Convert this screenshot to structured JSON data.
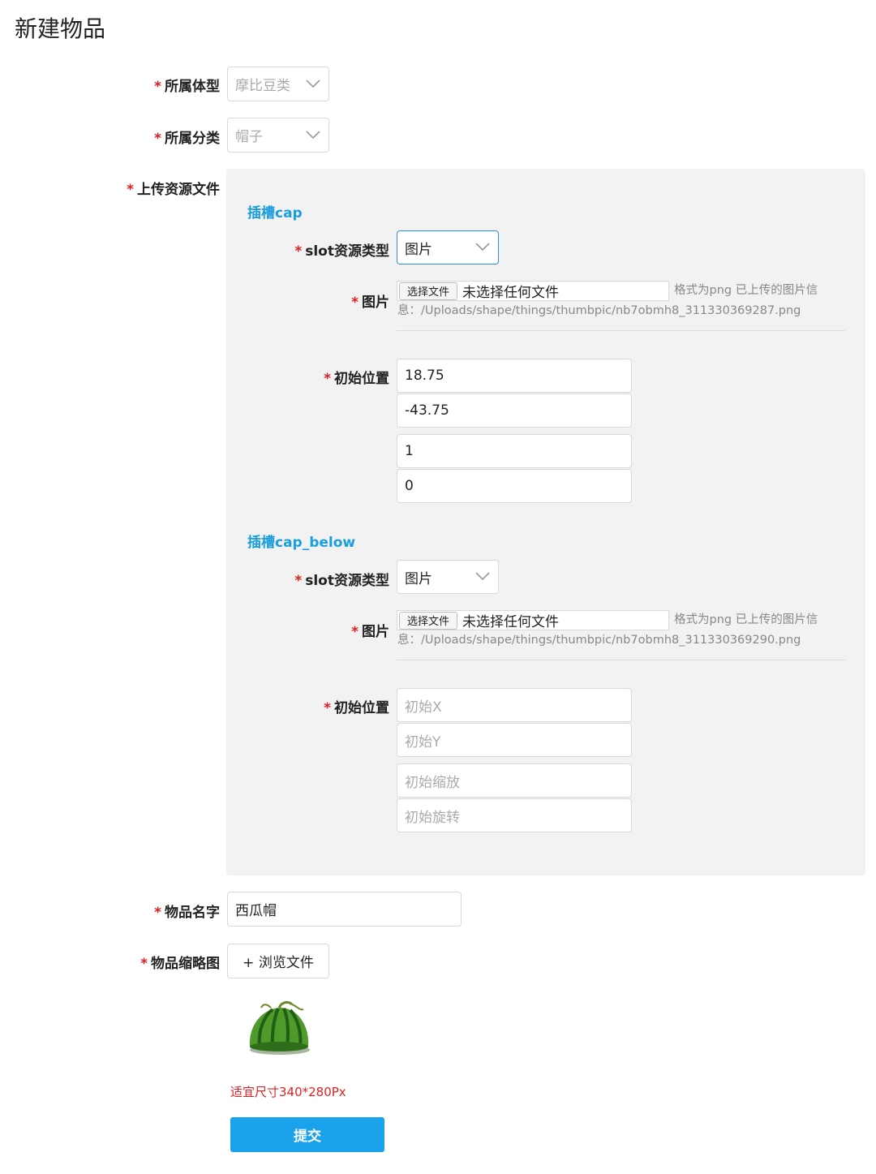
{
  "page": {
    "title": "新建物品"
  },
  "form": {
    "required_mark": "*",
    "body_type": {
      "label": "所属体型",
      "value": "摩比豆类"
    },
    "category": {
      "label": "所属分类",
      "value": "帽子"
    },
    "upload": {
      "label": "上传资源文件"
    },
    "slots": [
      {
        "title": "插槽cap",
        "type_label": "slot资源类型",
        "type_value": "图片",
        "image_label": "图片",
        "file_button": "选择文件",
        "file_status": "未选择任何文件",
        "info_line1": "格式为png 已上传的图片信",
        "info_line2": "息：/Uploads/shape/things/thumbpic/nb7obmh8_311330369287.png",
        "position_label": "初始位置",
        "x_value": "18.75",
        "y_value": "-43.75",
        "scale_value": "1",
        "rotate_value": "0"
      },
      {
        "title": "插槽cap_below",
        "type_label": "slot资源类型",
        "type_value": "图片",
        "image_label": "图片",
        "file_button": "选择文件",
        "file_status": "未选择任何文件",
        "info_line1": "格式为png 已上传的图片信",
        "info_line2": "息：/Uploads/shape/things/thumbpic/nb7obmh8_311330369290.png",
        "position_label": "初始位置",
        "x_placeholder": "初始X",
        "y_placeholder": "初始Y",
        "scale_placeholder": "初始缩放",
        "rotate_placeholder": "初始旋转"
      }
    ],
    "item_name": {
      "label": "物品名字",
      "value": "西瓜帽"
    },
    "thumbnail": {
      "label": "物品缩略图",
      "browse_label": "+ 浏览文件",
      "size_hint": "适宜尺寸340*280Px"
    },
    "submit_label": "提交"
  },
  "colors": {
    "accent": "#1a9ee0",
    "required": "#e02020",
    "submit": "#1aa3ea",
    "panel": "#f2f2f2"
  },
  "icons": [
    "chevron-down-icon",
    "watermelon-hat-thumbnail"
  ]
}
